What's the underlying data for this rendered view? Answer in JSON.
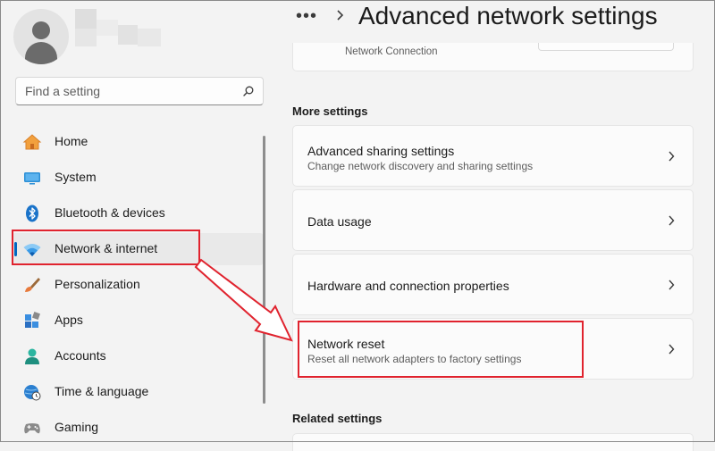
{
  "search": {
    "placeholder": "Find a setting"
  },
  "header": {
    "title": "Advanced network settings",
    "more": "•••"
  },
  "top_card": {
    "subtitle": "Network Connection"
  },
  "sidebar": {
    "items": [
      {
        "label": "Home",
        "icon": "home-icon"
      },
      {
        "label": "System",
        "icon": "system-icon"
      },
      {
        "label": "Bluetooth & devices",
        "icon": "bluetooth-icon"
      },
      {
        "label": "Network & internet",
        "icon": "wifi-icon",
        "selected": true
      },
      {
        "label": "Personalization",
        "icon": "brush-icon"
      },
      {
        "label": "Apps",
        "icon": "apps-icon"
      },
      {
        "label": "Accounts",
        "icon": "accounts-icon"
      },
      {
        "label": "Time & language",
        "icon": "clock-globe-icon"
      },
      {
        "label": "Gaming",
        "icon": "gamepad-icon"
      }
    ]
  },
  "more_settings": {
    "heading": "More settings",
    "items": [
      {
        "title": "Advanced sharing settings",
        "description": "Change network discovery and sharing settings"
      },
      {
        "title": "Data usage"
      },
      {
        "title": "Hardware and connection properties"
      },
      {
        "title": "Network reset",
        "description": "Reset all network adapters to factory settings"
      }
    ]
  },
  "related_settings": {
    "heading": "Related settings"
  },
  "colors": {
    "accent": "#0067c0",
    "annotation": "#e0232e",
    "background": "#f3f3f3",
    "card": "#fbfbfb"
  }
}
